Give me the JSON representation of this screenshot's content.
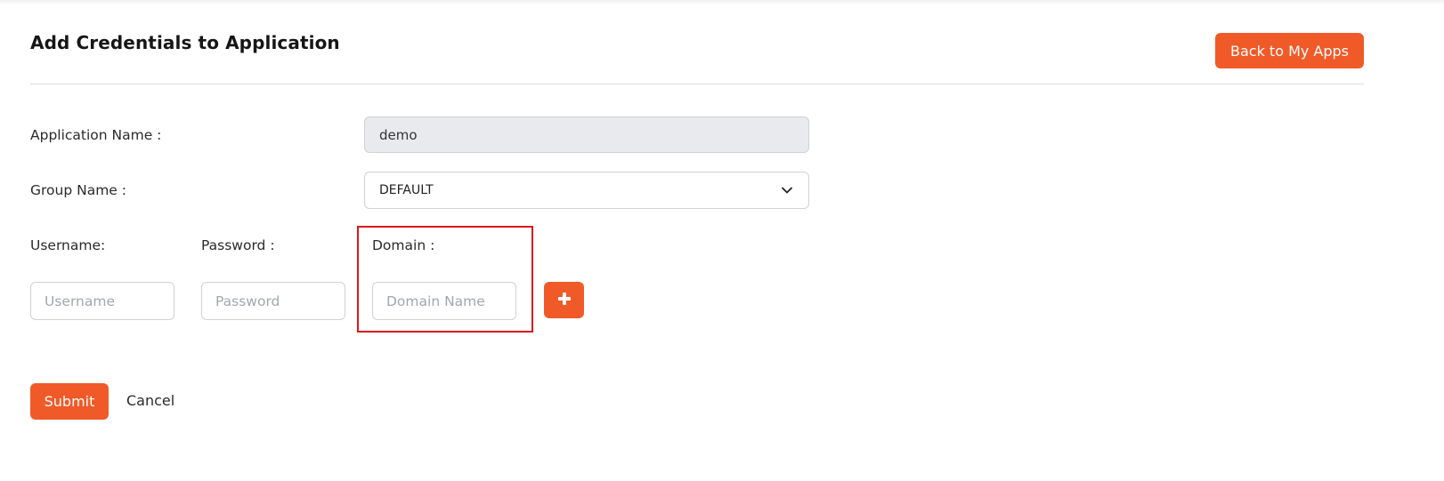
{
  "header": {
    "title": "Add Credentials to Application",
    "back_label": "Back to My Apps"
  },
  "form": {
    "application_name_label": "Application Name :",
    "application_name_value": "demo",
    "group_name_label": "Group Name :",
    "group_name_value": "DEFAULT",
    "username_label": "Username:",
    "password_label": "Password :",
    "domain_label": "Domain :",
    "username_placeholder": "Username",
    "password_placeholder": "Password",
    "domain_placeholder": "Domain Name",
    "add_icon": "plus-icon",
    "group_select_icon": "chevron-down-icon"
  },
  "actions": {
    "submit_label": "Submit",
    "cancel_label": "Cancel"
  },
  "colors": {
    "accent": "#f05a28",
    "highlight": "#d9191f",
    "readonly_bg": "#e9eaed"
  }
}
